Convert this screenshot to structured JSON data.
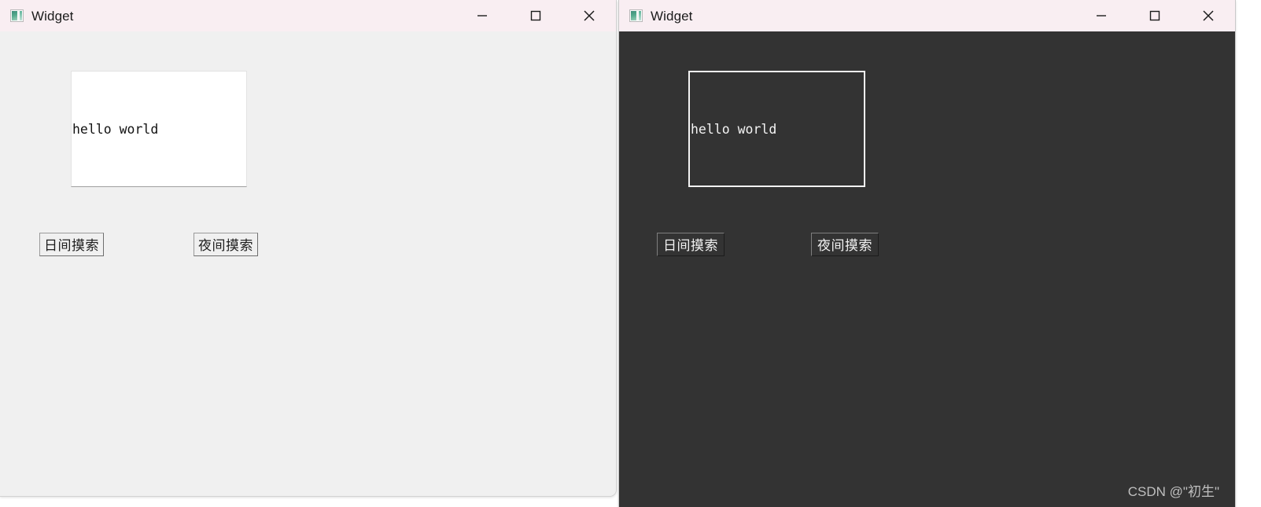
{
  "windows": {
    "light": {
      "title": "Widget",
      "icon": "qt-widget-icon",
      "label_text": "hello world",
      "buttons": {
        "day": "日间摸索",
        "night": "夜间摸索"
      },
      "controls": {
        "minimize": "minimize-icon",
        "maximize": "maximize-icon",
        "close": "close-icon"
      },
      "colors": {
        "titlebar": "#f9eef2",
        "body": "#f0f0f0",
        "label_background": "#ffffff",
        "text": "#121212"
      }
    },
    "dark": {
      "title": "Widget",
      "icon": "qt-widget-icon",
      "label_text": "hello world",
      "buttons": {
        "day": "日间摸索",
        "night": "夜间摸索"
      },
      "controls": {
        "minimize": "minimize-icon",
        "maximize": "maximize-icon",
        "close": "close-icon"
      },
      "colors": {
        "titlebar": "#f9eef2",
        "body": "#333333",
        "label_border": "#f3f3f3",
        "text": "#f4f4f4"
      },
      "watermark": "CSDN @\"初生\""
    }
  }
}
